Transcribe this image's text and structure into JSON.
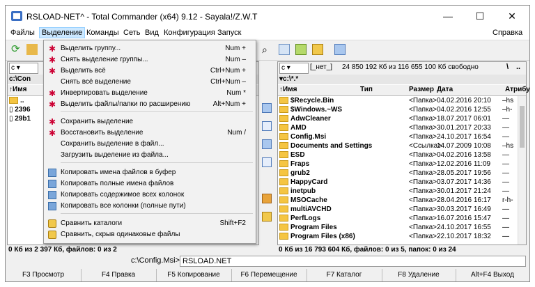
{
  "window": {
    "title": "RSLOAD-NET^ - Total Commander (x64) 9.12 - Sayala!/Z.W.T"
  },
  "menubar": {
    "items": [
      "Файлы",
      "Выделение",
      "Команды",
      "Сеть",
      "Вид",
      "Конфигурация",
      "Запуск"
    ],
    "help": "Справка"
  },
  "selection_menu": {
    "items": [
      {
        "label": "Выделить группу...",
        "shortcut": "Num +"
      },
      {
        "label": "Снять выделение группы...",
        "shortcut": "Num –"
      },
      {
        "label": "Выделить всё",
        "shortcut": "Ctrl+Num +"
      },
      {
        "label": "Снять всё выделение",
        "shortcut": "Ctrl+Num –"
      },
      {
        "label": "Инвертировать выделение",
        "shortcut": "Num *"
      },
      {
        "label": "Выделить файлы/папки по расширению",
        "shortcut": "Alt+Num +"
      },
      {
        "label": "Сохранить выделение",
        "shortcut": ""
      },
      {
        "label": "Восстановить выделение",
        "shortcut": "Num /"
      },
      {
        "label": "Сохранить выделение в файл...",
        "shortcut": ""
      },
      {
        "label": "Загрузить выделение из файла...",
        "shortcut": ""
      },
      {
        "label": "Копировать имена файлов в буфер",
        "shortcut": ""
      },
      {
        "label": "Копировать полные имена файлов",
        "shortcut": ""
      },
      {
        "label": "Копировать содержимое всех колонок",
        "shortcut": ""
      },
      {
        "label": "Копировать все колонки (полные пути)",
        "shortcut": ""
      },
      {
        "label": "Сравнить каталоги",
        "shortcut": "Shift+F2"
      },
      {
        "label": "Сравнить, скрыв одинаковые файлы",
        "shortcut": ""
      }
    ]
  },
  "left": {
    "drive": "c",
    "path": "c:\\Con",
    "header_name": "Имя",
    "rows": [
      "..",
      "2396",
      "29b1"
    ],
    "status": "0 Кб из 2 397 Кб, файлов: 0 из 2"
  },
  "right": {
    "drive": "c",
    "drive_label": "[_нет_]",
    "free": "24 850 192 Кб из 116 655 100 Кб свободно",
    "path": "c:\\*.*",
    "headers": {
      "name": "Имя",
      "type": "Тип",
      "size": "Размер",
      "date": "Дата",
      "attr": "Атрибу"
    },
    "rows": [
      {
        "name": "$Recycle.Bin",
        "size": "<Папка>",
        "date": "04.02.2016 20:10",
        "attr": "–hs"
      },
      {
        "name": "$Windows.~WS",
        "size": "<Папка>",
        "date": "04.02.2016 12:55",
        "attr": "–h-"
      },
      {
        "name": "AdwCleaner",
        "size": "<Папка>",
        "date": "18.07.2017 06:01",
        "attr": "—"
      },
      {
        "name": "AMD",
        "size": "<Папка>",
        "date": "30.01.2017 20:33",
        "attr": "—"
      },
      {
        "name": "Config.Msi",
        "size": "<Папка>",
        "date": "24.10.2017 16:54",
        "attr": "—"
      },
      {
        "name": "Documents and Settings",
        "size": "<Ссылка>",
        "date": "14.07.2009 10:08",
        "attr": "–hs"
      },
      {
        "name": "ESD",
        "size": "<Папка>",
        "date": "04.02.2016 13:58",
        "attr": "—"
      },
      {
        "name": "Fraps",
        "size": "<Папка>",
        "date": "12.02.2016 11:09",
        "attr": "—"
      },
      {
        "name": "grub2",
        "size": "<Папка>",
        "date": "28.05.2017 19:56",
        "attr": "—"
      },
      {
        "name": "HappyCard",
        "size": "<Папка>",
        "date": "03.07.2017 14:36",
        "attr": "—"
      },
      {
        "name": "inetpub",
        "size": "<Папка>",
        "date": "30.01.2017 21:24",
        "attr": "—"
      },
      {
        "name": "MSOCache",
        "size": "<Папка>",
        "date": "28.04.2016 16:17",
        "attr": "r-h-"
      },
      {
        "name": "multiAVCHD",
        "size": "<Папка>",
        "date": "30.03.2017 16:49",
        "attr": "—"
      },
      {
        "name": "PerfLogs",
        "size": "<Папка>",
        "date": "16.07.2016 15:47",
        "attr": "—"
      },
      {
        "name": "Program Files",
        "size": "<Папка>",
        "date": "24.10.2017 16:55",
        "attr": "—"
      },
      {
        "name": "Program Files (x86)",
        "size": "<Папка>",
        "date": "22.10.2017 18:32",
        "attr": "—"
      }
    ],
    "status": "0 Кб из 16 793 604 Кб, файлов: 0 из 5, папок: 0 из 24"
  },
  "cmdline": {
    "prompt": "c:\\Config.Msi>",
    "value": "RSLOAD.NET"
  },
  "fkeys": [
    "F3 Просмотр",
    "F4 Правка",
    "F5 Копирование",
    "F6 Перемещение",
    "F7 Каталог",
    "F8 Удаление",
    "Alt+F4 Выход"
  ]
}
